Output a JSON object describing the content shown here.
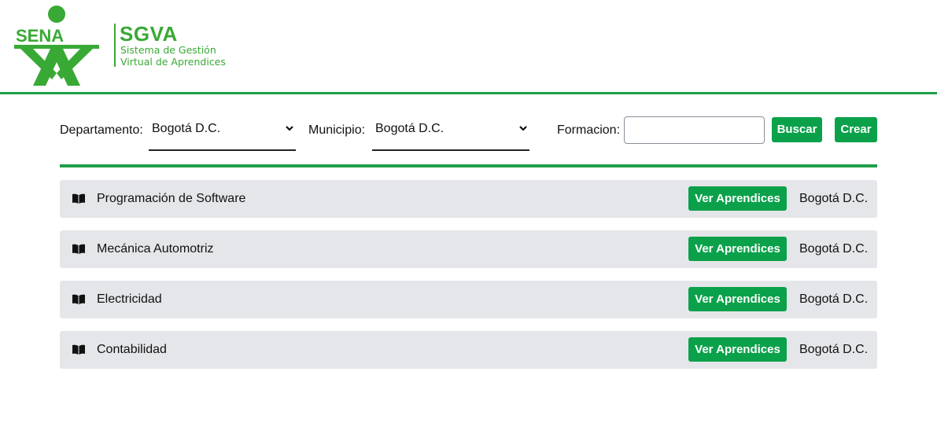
{
  "brand": {
    "logo_text": "SENA",
    "title": "SGVA",
    "subtitle_line1": "Sistema de Gestión",
    "subtitle_line2": "Virtual de Aprendices",
    "color": "#39a935"
  },
  "filters": {
    "departamento_label": "Departamento:",
    "departamento_value": "Bogotá D.C.",
    "municipio_label": "Municipio:",
    "municipio_value": "Bogotá D.C.",
    "formacion_label": "Formacion:",
    "formacion_value": "",
    "buscar_label": "Buscar",
    "crear_label": "Crear"
  },
  "accent": "#0aa14a",
  "rows": [
    {
      "name": "Programación de Software",
      "button": "Ver Aprendices",
      "city": "Bogotá D.C.",
      "icon": "book-icon"
    },
    {
      "name": "Mecánica Automotriz",
      "button": "Ver Aprendices",
      "city": "Bogotá D.C.",
      "icon": "book-icon"
    },
    {
      "name": "Electricidad",
      "button": "Ver Aprendices",
      "city": "Bogotá D.C.",
      "icon": "book-icon"
    },
    {
      "name": "Contabilidad",
      "button": "Ver Aprendices",
      "city": "Bogotá D.C.",
      "icon": "book-icon"
    }
  ]
}
